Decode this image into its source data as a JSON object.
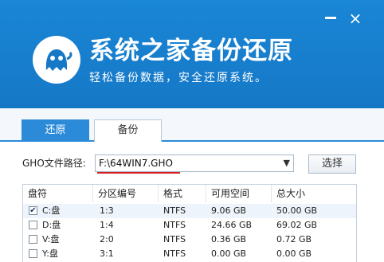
{
  "window": {
    "close_glyph": "×"
  },
  "app": {
    "title": "系统之家备份还原",
    "subtitle": "轻松备份数据，安全还原系统。",
    "logo_icon": "ghost-icon"
  },
  "tabs": [
    {
      "label": "还原",
      "active": true
    },
    {
      "label": "备份",
      "active": false
    }
  ],
  "gho": {
    "label": "GHO文件路径:",
    "path_value": "F:\\64WIN7.GHO",
    "browse_label": "选择"
  },
  "table": {
    "headers": [
      "盘符",
      "分区编号",
      "格式",
      "可用空间",
      "总大小"
    ],
    "rows": [
      {
        "checked": true,
        "drive": "C:盘",
        "partition": "1:3",
        "format": "NTFS",
        "free": "9.06 GB",
        "total": "50.00 GB"
      },
      {
        "checked": false,
        "drive": "D:盘",
        "partition": "1:4",
        "format": "NTFS",
        "free": "24.66 GB",
        "total": "69.02 GB"
      },
      {
        "checked": false,
        "drive": "V:盘",
        "partition": "2:0",
        "format": "NTFS",
        "free": "0.36 GB",
        "total": "0.72 GB"
      },
      {
        "checked": false,
        "drive": "Y:盘",
        "partition": "3:1",
        "format": "NTFS",
        "free": "0.00 GB",
        "total": "0.00 GB"
      }
    ]
  },
  "colors": {
    "header_blue": "#1578c6",
    "tab_active": "#2b8bd8",
    "path_underline": "#d62020"
  }
}
